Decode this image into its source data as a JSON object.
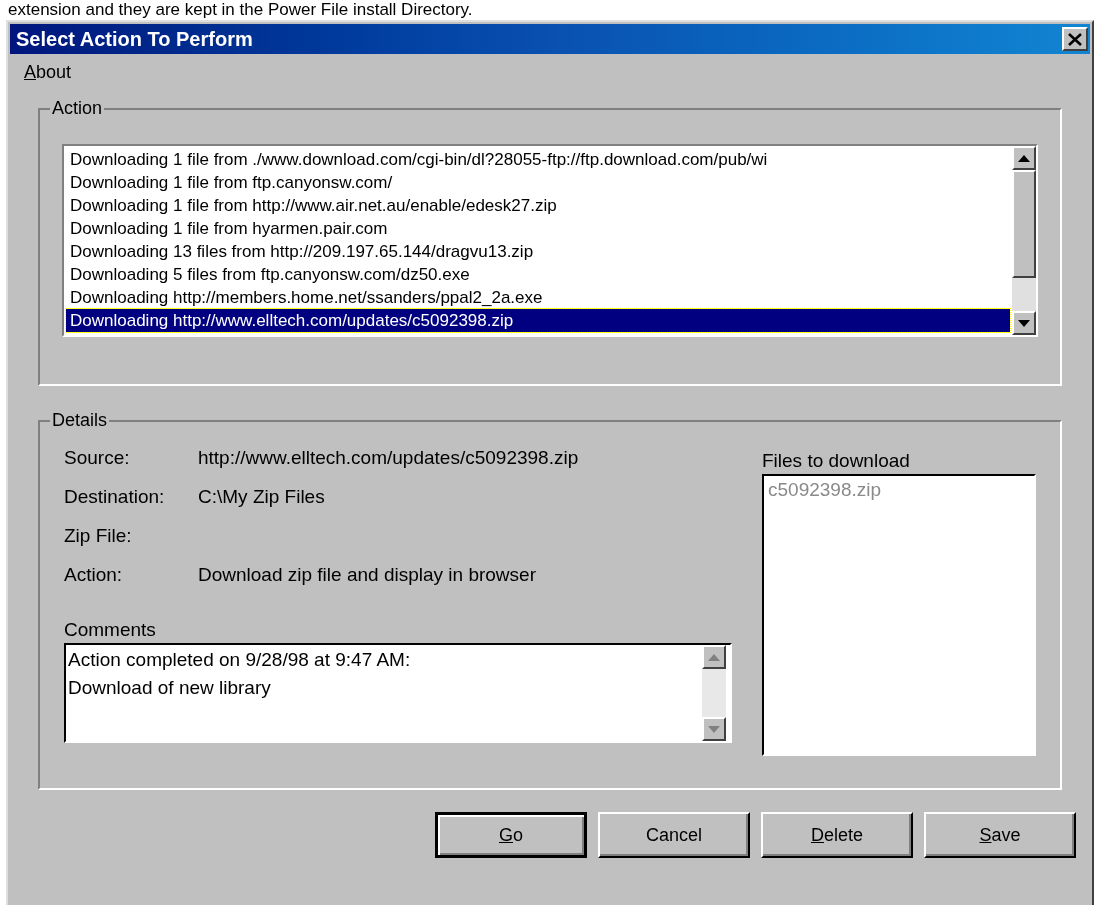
{
  "caption": "extension and they are kept in the Power File install Directory.",
  "window": {
    "title": "Select Action To Perform"
  },
  "menu": [
    {
      "label": "About",
      "underline_first": true
    }
  ],
  "action": {
    "legend": "Action",
    "items": [
      {
        "label": "Downloading 1 file from ./www.download.com/cgi-bin/dl?28055-ftp://ftp.download.com/pub/wi",
        "selected": false
      },
      {
        "label": "Downloading 1 file from ftp.canyonsw.com/",
        "selected": false
      },
      {
        "label": "Downloading 1 file from http://www.air.net.au/enable/edesk27.zip",
        "selected": false
      },
      {
        "label": "Downloading 1 file from hyarmen.pair.com",
        "selected": false
      },
      {
        "label": "Downloading 13 files from http://209.197.65.144/dragvu13.zip",
        "selected": false
      },
      {
        "label": "Downloading 5 files from ftp.canyonsw.com/dz50.exe",
        "selected": false
      },
      {
        "label": "Downloading http://members.home.net/ssanders/ppal2_2a.exe",
        "selected": false
      },
      {
        "label": "Downloading http://www.elltech.com/updates/c5092398.zip",
        "selected": true
      }
    ]
  },
  "details": {
    "legend": "Details",
    "fields": [
      {
        "label": "Source:",
        "value": "http://www.elltech.com/updates/c5092398.zip"
      },
      {
        "label": "Destination:",
        "value": "C:\\My Zip Files"
      },
      {
        "label": "Zip File:"
      },
      {
        "label": "Action:",
        "value": "Download zip file and display in browser"
      }
    ],
    "comments_label": "Comments",
    "comments": [
      "Action completed on 9/28/98 at 9:47 AM:",
      "Download of new library"
    ],
    "files_label": "Files to download",
    "files": [
      {
        "name": "c5092398.zip",
        "disabled": true
      }
    ]
  },
  "buttons": [
    {
      "label": "Go",
      "underline_first": true,
      "default": true
    },
    {
      "label": "Cancel",
      "underline_first": false,
      "default": false
    },
    {
      "label": "Delete",
      "underline_first": true,
      "default": false
    },
    {
      "label": "Save",
      "underline_first": true,
      "default": false
    }
  ]
}
